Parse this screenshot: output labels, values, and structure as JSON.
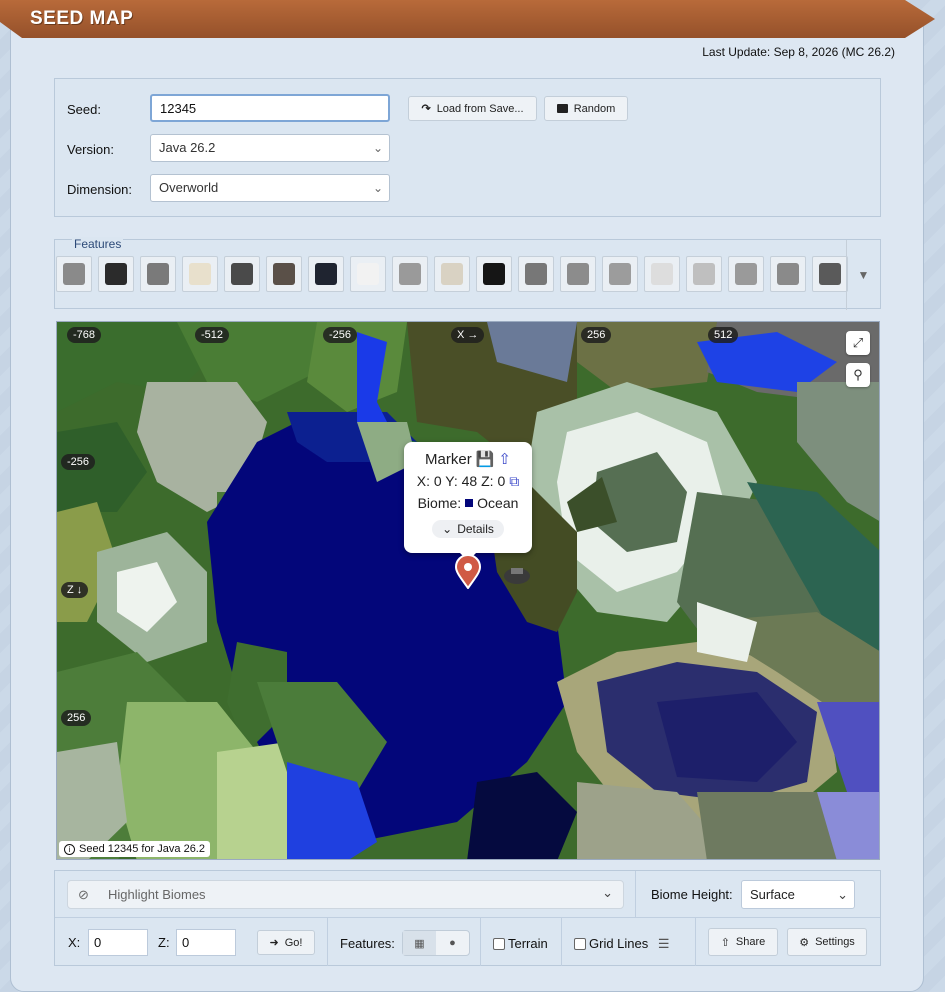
{
  "header": {
    "title": "SEED MAP",
    "last_update": "Last Update: Sep 8, 2026 (MC 26.2)"
  },
  "form": {
    "seed_label": "Seed:",
    "seed_value": "12345",
    "version_label": "Version:",
    "version_value": "Java 26.2",
    "dimension_label": "Dimension:",
    "dimension_value": "Overworld",
    "load_button": "Load from Save...",
    "random_button": "Random"
  },
  "features": {
    "title": "Features",
    "items": [
      {
        "name": "mineshaft",
        "color": "#8a8a8a"
      },
      {
        "name": "stronghold",
        "color": "#2b2b2b"
      },
      {
        "name": "dungeon",
        "color": "#7a7a7a"
      },
      {
        "name": "desert-temple",
        "color": "#e8e0cc"
      },
      {
        "name": "pillager-outpost",
        "color": "#4a4a4a"
      },
      {
        "name": "jungle-temple",
        "color": "#5a5048"
      },
      {
        "name": "shipwreck-anchor",
        "color": "#1f2430"
      },
      {
        "name": "snowball",
        "color": "#f2f2f2"
      },
      {
        "name": "igloo",
        "color": "#9a9a9a"
      },
      {
        "name": "fossil",
        "color": "#d9d2c3"
      },
      {
        "name": "obsidian",
        "color": "#151515"
      },
      {
        "name": "ruined-portal",
        "color": "#777777"
      },
      {
        "name": "trail-ruins",
        "color": "#8c8c8c"
      },
      {
        "name": "amethyst",
        "color": "#9c9c9c"
      },
      {
        "name": "apple",
        "color": "#dddddd"
      },
      {
        "name": "mansion",
        "color": "#bfbfbf"
      },
      {
        "name": "barrel",
        "color": "#9a9a9a"
      },
      {
        "name": "spyglass",
        "color": "#8a8a8a"
      },
      {
        "name": "trial-chamber",
        "color": "#5a5a5a"
      }
    ]
  },
  "map": {
    "x_ticks": [
      "-768",
      "-512",
      "-256",
      "X →",
      "256",
      "512"
    ],
    "y_ticks": [
      "-256",
      "Z ↓",
      "256"
    ],
    "popup": {
      "title": "Marker",
      "coords": "X: 0 Y: 48 Z: 0",
      "biome_label": "Biome:",
      "biome_value": "Ocean",
      "details": "Details"
    },
    "caption": "Seed 12345 for Java 26.2"
  },
  "controls": {
    "highlight_placeholder": "Highlight Biomes",
    "biome_height_label": "Biome Height:",
    "biome_height_value": "Surface",
    "x_label": "X:",
    "x_value": "0",
    "z_label": "Z:",
    "z_value": "0",
    "go_button": "Go!",
    "features_label": "Features:",
    "terrain_label": "Terrain",
    "grid_label": "Grid Lines",
    "share_button": "Share",
    "settings_button": "Settings"
  }
}
